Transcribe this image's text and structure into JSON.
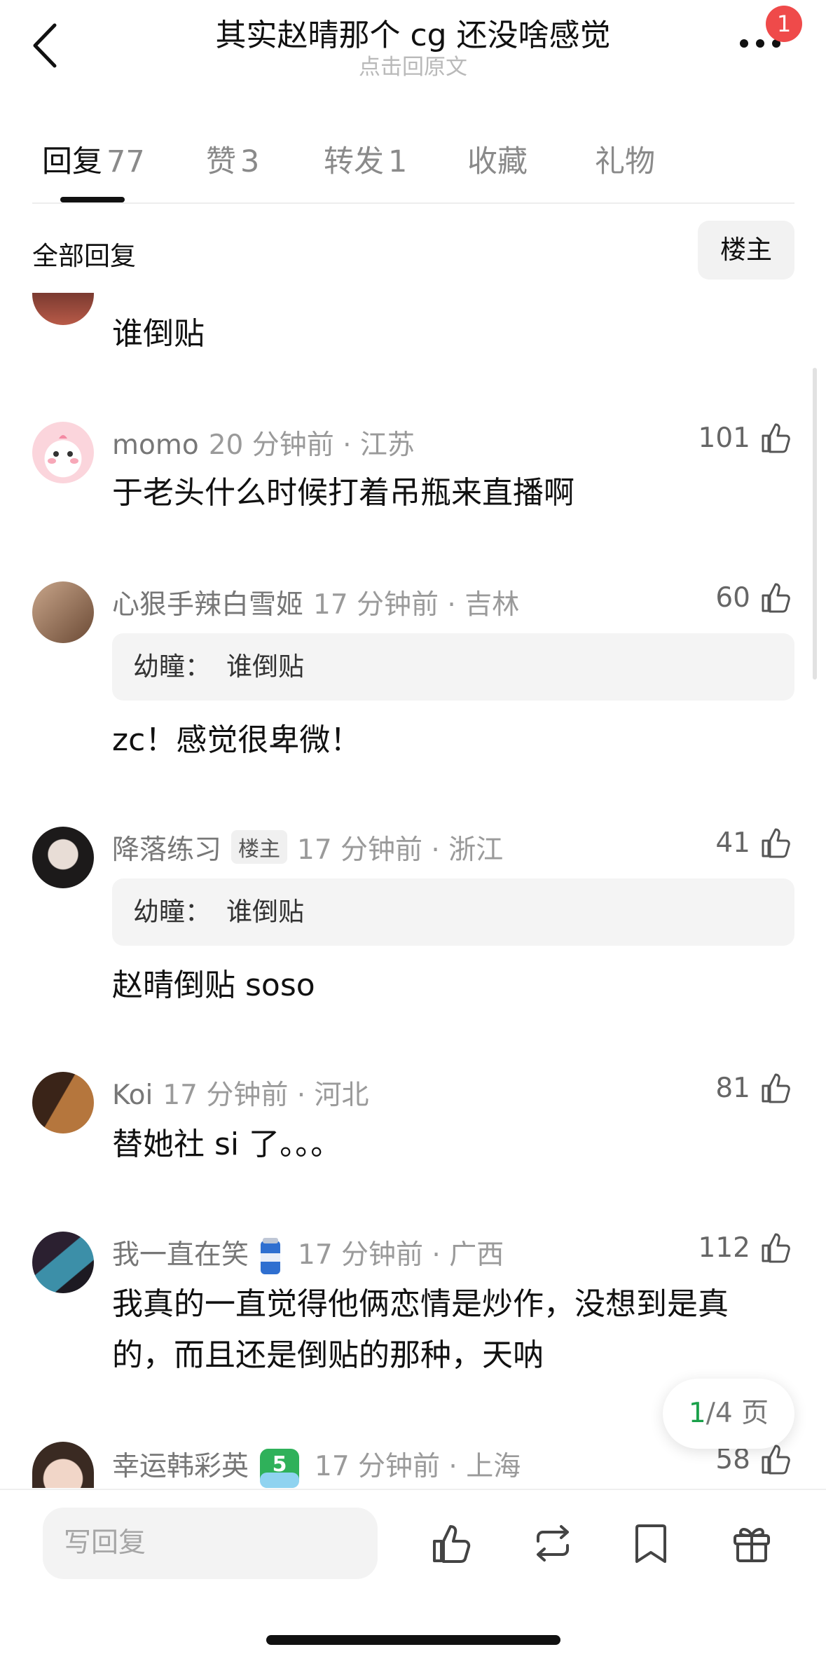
{
  "header": {
    "title": "其实赵晴那个 cg 还没啥感觉",
    "subtitle": "点击回原文",
    "notification_count": "1"
  },
  "tabs": [
    {
      "label": "回复",
      "count": "77",
      "active": true
    },
    {
      "label": "赞",
      "count": "3",
      "active": false
    },
    {
      "label": "转发",
      "count": "1",
      "active": false
    },
    {
      "label": "收藏",
      "count": "",
      "active": false
    },
    {
      "label": "礼物",
      "count": "",
      "active": false
    }
  ],
  "section": {
    "title": "全部回复",
    "filter_label": "楼主"
  },
  "comments": [
    {
      "id": 0,
      "text": "谁倒贴"
    },
    {
      "id": 1,
      "name": "momo",
      "time": "20 分钟前 · 江苏",
      "likes": "101",
      "text": "于老头什么时候打着吊瓶来直播啊"
    },
    {
      "id": 2,
      "name": "心狠手辣白雪姬",
      "time": "17 分钟前 · 吉林",
      "likes": "60",
      "quote_name": "幼瞳：",
      "quote_text": "谁倒贴",
      "text": "zc！感觉很卑微！"
    },
    {
      "id": 3,
      "name": "降落练习",
      "tag": "楼主",
      "time": "17 分钟前 · 浙江",
      "likes": "41",
      "quote_name": "幼瞳：",
      "quote_text": "谁倒贴",
      "text": "赵晴倒贴 soso"
    },
    {
      "id": 4,
      "name": "Koi",
      "time": "17 分钟前 · 河北",
      "likes": "81",
      "text": "替她社 si 了。。。"
    },
    {
      "id": 5,
      "name": "我一直在笑",
      "time": "17 分钟前 · 广西",
      "likes": "112",
      "text_line1": "我真的一直觉得他俩恋情是炒作，没想到是真",
      "text_line2": "的，而且还是倒贴的那种，天呐"
    },
    {
      "id": 6,
      "name": "幸运韩彩英",
      "level": "5",
      "time": "17 分钟前 · 上海",
      "likes": "58"
    }
  ],
  "pagination": {
    "current": "1",
    "rest": "/4 页"
  },
  "bottom_bar": {
    "reply_placeholder": "写回复"
  },
  "colors": {
    "accent_green": "#1aa04a",
    "badge_red": "#ef4a4a"
  }
}
